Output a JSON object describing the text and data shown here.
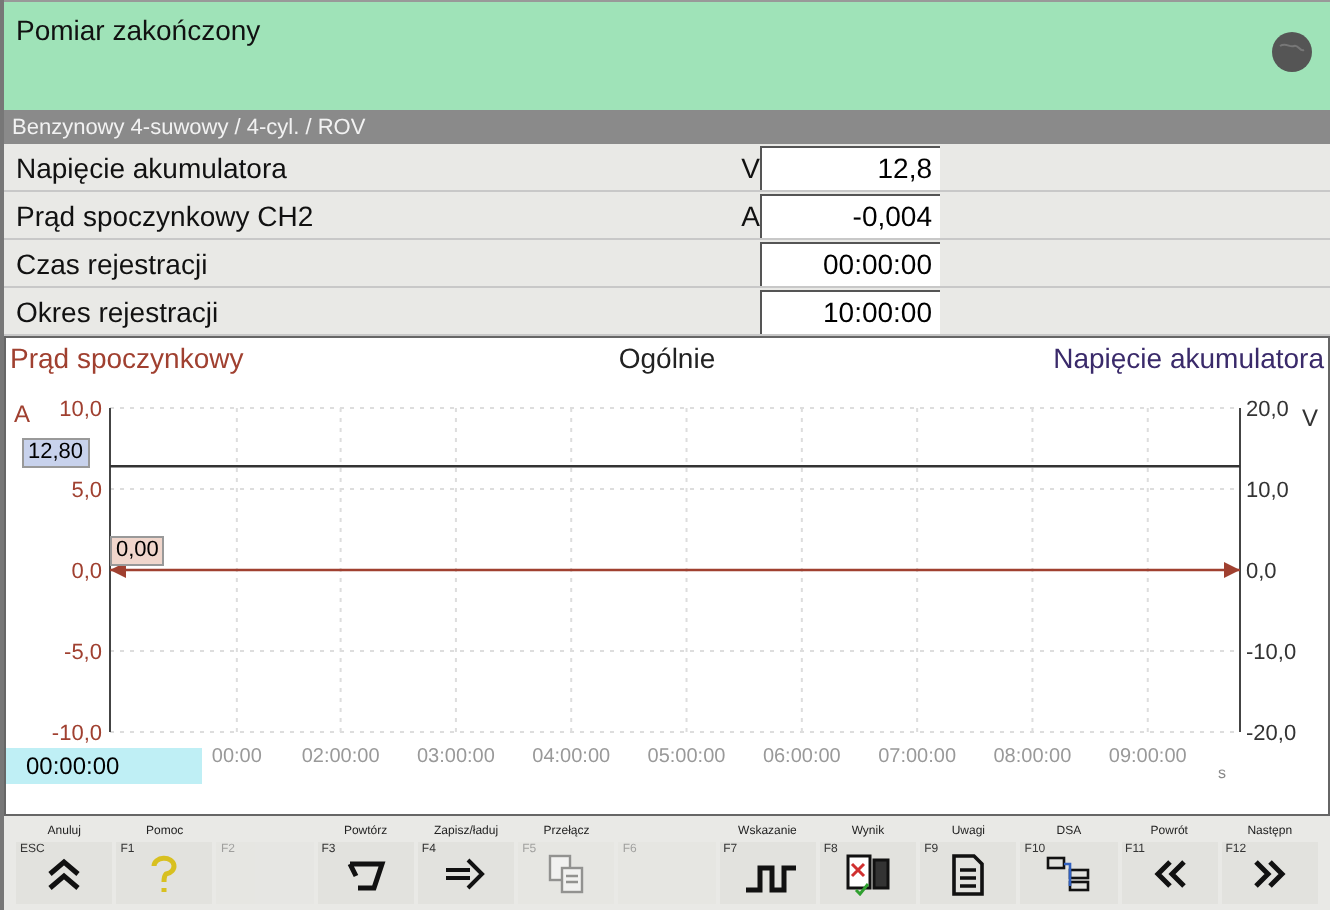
{
  "status": {
    "title": "Pomiar zakończony"
  },
  "breadcrumb": "Benzynowy 4-suwowy / 4-cyl. / ROV",
  "readings": [
    {
      "label": "Napięcie akumulatora",
      "unit": "V",
      "value": "12,8"
    },
    {
      "label": "Prąd spoczynkowy CH2",
      "unit": "A",
      "value": "-0,004"
    },
    {
      "label": "Czas rejestracji",
      "value": "00:00:00"
    },
    {
      "label": "Okres rejestracji",
      "value": "10:00:00"
    }
  ],
  "chart": {
    "center_title": "Ogólnie",
    "cursor_time": "00:00:00",
    "cursor_values": [
      "12,80",
      "0,00"
    ],
    "chart_data": {
      "type": "line",
      "grid": true,
      "xlabel": "s",
      "ylabel": "A",
      "y2label": "V",
      "x": [
        0,
        9.8
      ],
      "xlim": [
        0,
        9.8
      ],
      "ylim": [
        -10,
        10
      ],
      "y2lim": [
        -20,
        20
      ],
      "yticks": [
        {
          "value": 10,
          "label": "10,0"
        },
        {
          "value": 5,
          "label": "5,0"
        },
        {
          "value": 0,
          "label": "0,0"
        },
        {
          "value": -5,
          "label": "-5,0"
        },
        {
          "value": -10,
          "label": "-10,0"
        }
      ],
      "y2ticks": [
        {
          "value": 20,
          "label": "20,0"
        },
        {
          "value": 10,
          "label": "10,0"
        },
        {
          "value": 0,
          "label": "0,0"
        },
        {
          "value": -10,
          "label": "-10,0"
        },
        {
          "value": -20,
          "label": "-20,0"
        }
      ],
      "xticks": [
        {
          "value": 1.1,
          "label": "00:00"
        },
        {
          "value": 2,
          "label": "02:00:00"
        },
        {
          "value": 3,
          "label": "03:00:00"
        },
        {
          "value": 4,
          "label": "04:00:00"
        },
        {
          "value": 5,
          "label": "05:00:00"
        },
        {
          "value": 6,
          "label": "06:00:00"
        },
        {
          "value": 7,
          "label": "07:00:00"
        },
        {
          "value": 8,
          "label": "08:00:00"
        },
        {
          "value": 9,
          "label": "09:00:00"
        }
      ],
      "series": [
        {
          "name": "Prąd spoczynkowy",
          "color": "#a04030",
          "values": [
            0,
            0
          ]
        },
        {
          "name": "Napięcie akumulatora",
          "color": "#333333",
          "axis": "y2",
          "values": [
            12.8,
            12.8
          ]
        }
      ]
    }
  },
  "toolbar": [
    {
      "label": "Anuluj",
      "key": "ESC",
      "kind": "up",
      "disabled": false
    },
    {
      "label": "Pomoc",
      "key": "F1",
      "kind": "help",
      "disabled": false
    },
    {
      "key": "F2",
      "disabled": true
    },
    {
      "label": "Powtórz",
      "key": "F3",
      "kind": "repeat",
      "disabled": false
    },
    {
      "label": "Zapisz/ładuj",
      "key": "F4",
      "kind": "saveload",
      "disabled": false
    },
    {
      "label": "Przełącz",
      "key": "F5",
      "kind": "docs",
      "disabled": true
    },
    {
      "key": "F6",
      "disabled": true
    },
    {
      "label": "Wskazanie",
      "key": "F7",
      "kind": "wave",
      "disabled": false
    },
    {
      "label": "Wynik",
      "key": "F8",
      "kind": "result",
      "disabled": false
    },
    {
      "label": "Uwagi",
      "key": "F9",
      "kind": "note",
      "disabled": false
    },
    {
      "label": "DSA",
      "key": "F10",
      "kind": "dsa",
      "disabled": false
    },
    {
      "label": "Powrót",
      "key": "F11",
      "kind": "back",
      "disabled": false
    },
    {
      "label": "Następn",
      "key": "F12",
      "kind": "next",
      "disabled": false
    }
  ]
}
